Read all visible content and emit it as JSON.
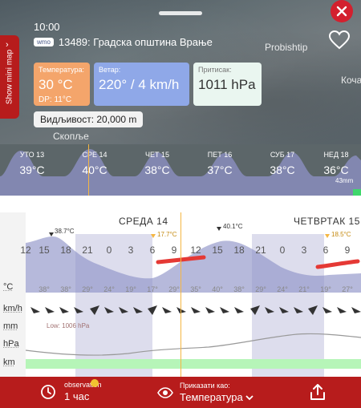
{
  "header": {
    "time": "10:00",
    "station_badge": "wmo",
    "station_name": "13489: Градска општина Врање",
    "map_labels": [
      "Probishtip",
      "Коча",
      "Скопље"
    ],
    "mini_map_toggle": "Show mini map"
  },
  "cards": {
    "temperature": {
      "label": "Температура:",
      "value": "30 °C",
      "dew_point": "DP: 11°C"
    },
    "wind": {
      "label": "Ветар:",
      "value": "220° / 4 km/h"
    },
    "pressure": {
      "label": "Притисак:",
      "value": "1011 hPa"
    },
    "visibility": "Видљивост: 20,000 m"
  },
  "days": [
    {
      "name": "УТО 13",
      "temp": "39°C"
    },
    {
      "name": "СРЕ 14",
      "temp": "40°C"
    },
    {
      "name": "ЧЕТ 15",
      "temp": "38°C"
    },
    {
      "name": "ПЕТ 16",
      "temp": "37°C"
    },
    {
      "name": "СУБ 17",
      "temp": "38°C"
    },
    {
      "name": "НЕД 18",
      "temp": "36°C"
    }
  ],
  "rain_total": "43mm",
  "meteogram": {
    "day_labels": [
      "СРЕДА 14",
      "ЧЕТВРТАК 15"
    ],
    "hours": [
      "12",
      "15",
      "18",
      "21",
      "0",
      "3",
      "6",
      "9",
      "12",
      "15",
      "18",
      "21",
      "0",
      "3",
      "6",
      "9"
    ],
    "temps": [
      "",
      "38°",
      "38°",
      "29°",
      "24°",
      "19°",
      "17°",
      "29°",
      "35°",
      "40°",
      "38°",
      "29°",
      "24°",
      "21°",
      "19°",
      "27°"
    ],
    "peaks": [
      "38.7°C",
      "17.7°C",
      "40.1°C",
      "18.5°C"
    ],
    "row_labels": [
      "°C",
      "km/h",
      "mm",
      "hPa",
      "km"
    ],
    "low_pressure": "Low: 1006 hPa"
  },
  "bottom": {
    "observation_label": "observation",
    "observation_value": "1 час",
    "show_as_label": "Приказати као:",
    "show_as_value": "Температура"
  },
  "colors": {
    "accent": "#b71c1c",
    "temp_card": "#f4a56b",
    "wind_card": "#8fa8e8",
    "pressure_card": "#eaf6f0",
    "marker": "#f5b642"
  }
}
